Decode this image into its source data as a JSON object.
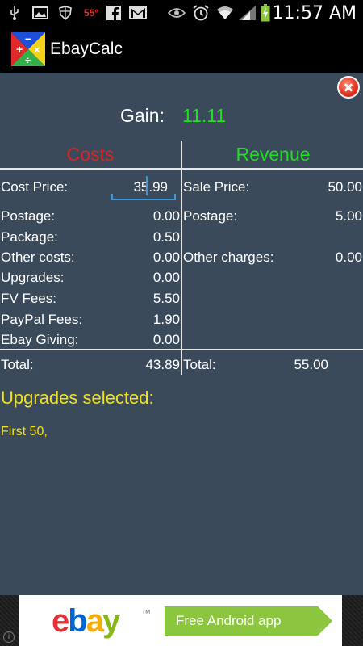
{
  "status_bar": {
    "temperature": "55°",
    "time": "11:57 AM",
    "icons": [
      "usb-icon",
      "image-icon",
      "shield-icon",
      "temperature-badge",
      "facebook-icon",
      "gmail-icon",
      "eye-icon",
      "alarm-icon",
      "wifi-icon",
      "signal-icon",
      "battery-charging-icon"
    ]
  },
  "app": {
    "title": "EbayCalc"
  },
  "gain": {
    "label": "Gain:",
    "value": "11.11"
  },
  "costs": {
    "heading": "Costs",
    "cost_price_label": "Cost Price:",
    "cost_price_value": "35.99",
    "rows": [
      {
        "label": "Postage:",
        "value": "0.00"
      },
      {
        "label": "Package:",
        "value": "0.50"
      },
      {
        "label": "Other costs:",
        "value": "0.00"
      },
      {
        "label": "Upgrades:",
        "value": "0.00"
      },
      {
        "label": "FV Fees:",
        "value": "5.50"
      },
      {
        "label": "PayPal Fees:",
        "value": "1.90"
      },
      {
        "label": "Ebay Giving:",
        "value": "0.00"
      }
    ],
    "total_label": "Total:",
    "total_value": "43.89"
  },
  "revenue": {
    "heading": "Revenue",
    "rows": [
      {
        "label": "Sale Price:",
        "value": "50.00"
      },
      {
        "label": "Postage:",
        "value": "5.00"
      },
      {
        "label": "Other charges:",
        "value": "0.00"
      }
    ],
    "total_label": "Total:",
    "total_value": "55.00"
  },
  "upgrades": {
    "heading": "Upgrades selected:",
    "list": "First 50,"
  },
  "ad": {
    "brand": "ebay",
    "tm": "TM",
    "cta": "Free Android app",
    "info": "i"
  },
  "colors": {
    "background": "#3a4a5a",
    "costs": "#dd2222",
    "revenue": "#22dd22",
    "upgrades": "#f0e020",
    "ad_green": "#8cc63f"
  }
}
